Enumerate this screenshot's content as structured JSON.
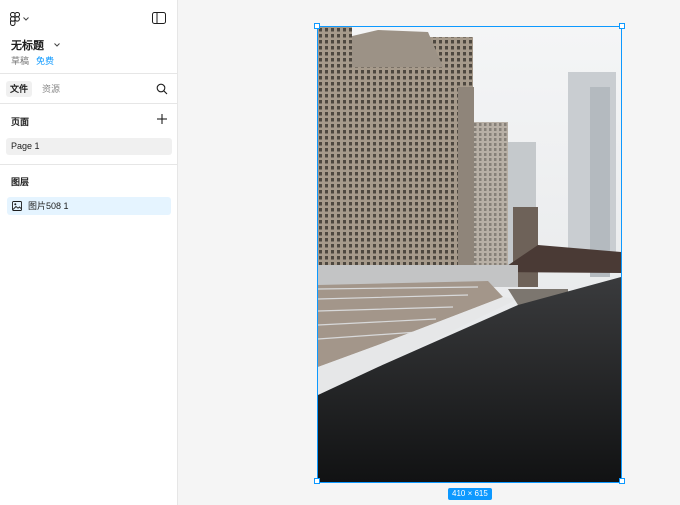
{
  "file": {
    "name": "无标题",
    "status": "草稿",
    "plan": "免费"
  },
  "tabs": [
    {
      "label": "文件"
    },
    {
      "label": "资源"
    }
  ],
  "pages": {
    "heading": "页面",
    "items": [
      {
        "label": "Page 1"
      }
    ]
  },
  "layers": {
    "heading": "图层",
    "items": [
      {
        "label": "图片508 1"
      }
    ]
  },
  "canvas": {
    "selection_size": "410 × 615"
  },
  "icons": {
    "logo": "figma-logo-icon",
    "panel": "sidebar-toggle-icon",
    "search": "search-icon",
    "add": "plus-icon",
    "layer": "image-icon"
  },
  "colors": {
    "accent": "#0d99ff",
    "selected_row": "#e5f4ff",
    "canvas_bg": "#f5f5f5"
  }
}
